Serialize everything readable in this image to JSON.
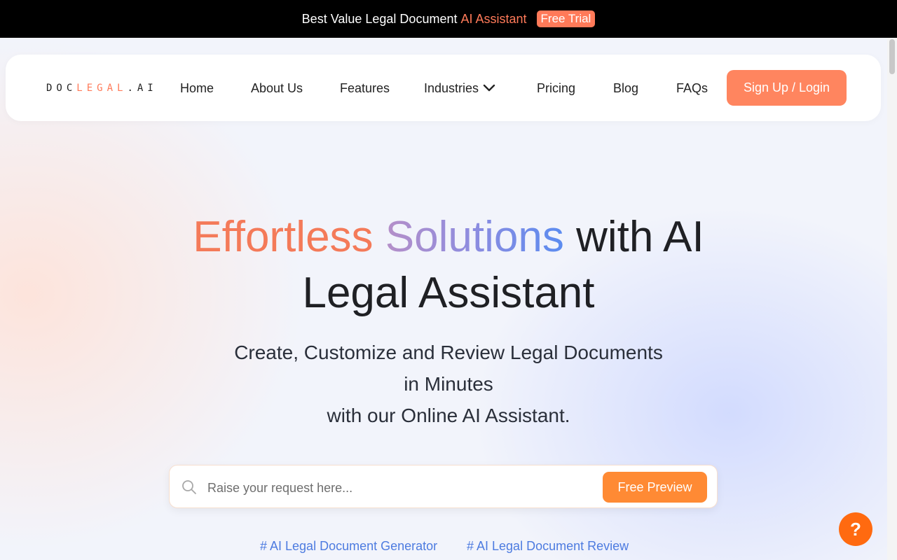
{
  "promo": {
    "text": "Best Value Legal Document",
    "accent": "AI Assistant",
    "badge": "Free Trial"
  },
  "nav": {
    "logo_left": "DOC",
    "logo_mid": "LEGAL",
    "logo_right": ".AI",
    "items": [
      "Home",
      "About Us",
      "Features",
      "Industries",
      "Pricing",
      "Blog",
      "FAQs"
    ],
    "signup": "Sign Up / Login"
  },
  "hero": {
    "title_part1": "Effortless",
    "title_part2": "Solutions",
    "title_part3": "with AI",
    "title_line2": "Legal Assistant",
    "subtitle_line1": "Create, Customize and Review Legal Documents",
    "subtitle_line2": "in Minutes",
    "subtitle_line3": "with our Online AI Assistant."
  },
  "search": {
    "placeholder": "Raise your request here...",
    "button": "Free Preview"
  },
  "tags": [
    "# AI Legal Document Generator",
    "# AI Legal Document Review"
  ],
  "help": {
    "label": "?"
  },
  "colors": {
    "accent": "#ff7a59",
    "button_orange": "#ff8a34",
    "tag_blue": "#4d7be0",
    "help_orange": "#ff6a10"
  },
  "icons": [
    "search-icon",
    "chevron-down-icon",
    "help-icon"
  ]
}
